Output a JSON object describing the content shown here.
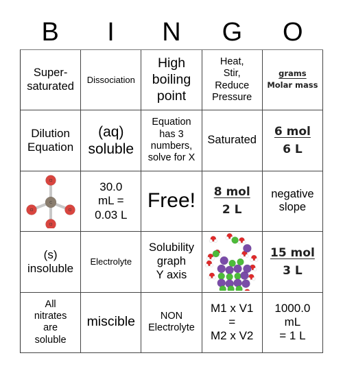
{
  "header": {
    "letters": [
      "B",
      "I",
      "N",
      "G",
      "O"
    ]
  },
  "cells": [
    {
      "text": "Super-\nsaturated"
    },
    {
      "text": "Dissociation"
    },
    {
      "text": "High\nboiling\npoint"
    },
    {
      "text": "Heat,\nStir,\nReduce\nPressure"
    },
    {
      "numerator": "grams",
      "denominator": "Molar mass"
    },
    {
      "text": "Dilution\nEquation"
    },
    {
      "text": "(aq)\nsoluble"
    },
    {
      "text": "Equation\nhas 3\nnumbers,\nsolve for X"
    },
    {
      "text": "Saturated"
    },
    {
      "numerator": "6 mol",
      "denominator": "6 L"
    },
    {
      "image": "ccl4-molecule",
      "atoms": {
        "center": "C",
        "outer": "Cl"
      }
    },
    {
      "text": "30.0\nmL =\n0.03 L"
    },
    {
      "text": "Free!"
    },
    {
      "numerator": "8 mol",
      "denominator": "2 L"
    },
    {
      "text": "negative\nslope"
    },
    {
      "text": "(s)\ninsoluble"
    },
    {
      "text": "Electrolyte"
    },
    {
      "text": "Solubility\ngraph\nY axis"
    },
    {
      "image": "nacl-dissolving-in-water"
    },
    {
      "numerator": "15 mol",
      "denominator": "3 L"
    },
    {
      "text": "All\nnitrates\nare\nsoluble"
    },
    {
      "text": "miscible"
    },
    {
      "text": "NON\nElectrolyte"
    },
    {
      "text": "M1 x V1\n=\nM2 x V2"
    },
    {
      "text": "1000.0\nmL\n= 1 L"
    }
  ],
  "colors": {
    "chlorine_atom": "#d9453f",
    "carbon_atom": "#8a7d6e",
    "sodium_atom": "#7a4ca8",
    "chloride_ion": "#4dbb3a",
    "oxygen_atom": "#e02a2a",
    "hydrogen_atom": "#ffffff"
  }
}
